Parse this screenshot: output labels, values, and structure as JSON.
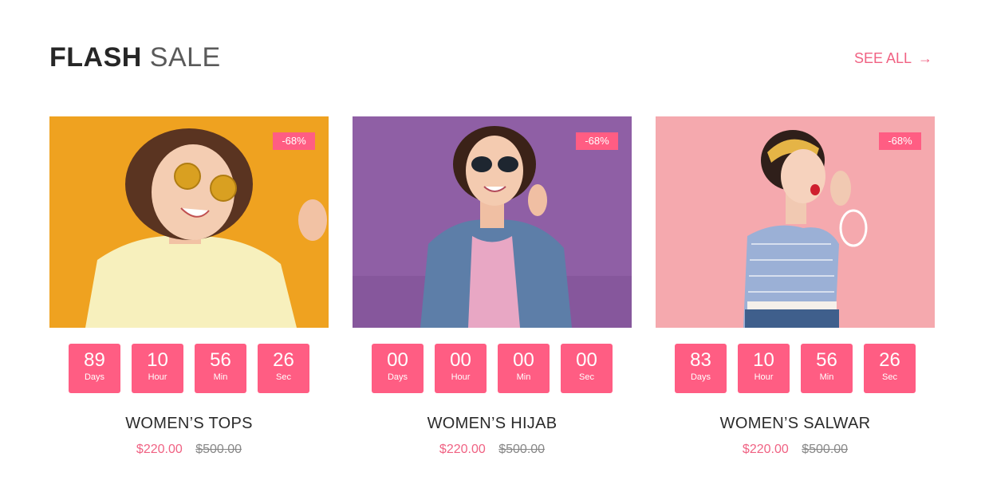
{
  "section": {
    "title_bold": "FLASH",
    "title_light": "SALE",
    "see_all": "SEE ALL",
    "see_all_arrow": "→"
  },
  "products": [
    {
      "badge": "-68%",
      "title": "WOMEN’S TOPS",
      "price": "$220.00",
      "old_price": "$500.00",
      "timer": {
        "days": "89",
        "hours": "10",
        "mins": "56",
        "secs": "26"
      },
      "bg_color": "#f3a522"
    },
    {
      "badge": "-68%",
      "title": "WOMEN’S HIJAB",
      "price": "$220.00",
      "old_price": "$500.00",
      "timer": {
        "days": "00",
        "hours": "00",
        "mins": "00",
        "secs": "00"
      },
      "bg_color": "#8f5fa5"
    },
    {
      "badge": "-68%",
      "title": "WOMEN’S SALWAR",
      "price": "$220.00",
      "old_price": "$500.00",
      "timer": {
        "days": "83",
        "hours": "10",
        "mins": "56",
        "secs": "26"
      },
      "bg_color": "#f5a9ae"
    }
  ],
  "timer_labels": {
    "days": "Days",
    "hours": "Hour",
    "mins": "Min",
    "secs": "Sec"
  },
  "colors": {
    "accent": "#ff5d83",
    "link": "#f06283",
    "old_price": "#888888"
  }
}
